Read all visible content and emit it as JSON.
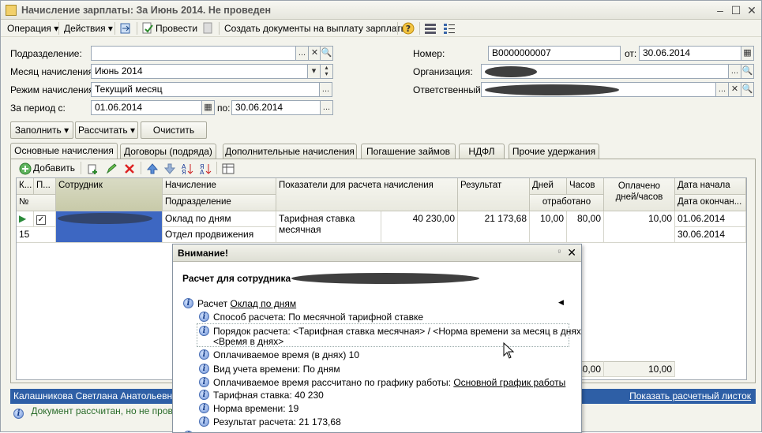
{
  "window": {
    "title": "Начисление зарплаты: За Июнь 2014. Не проведен"
  },
  "toolbar": {
    "operation": "Операция",
    "actions": "Действия",
    "post": "Провести",
    "create_docs": "Создать документы на выплату зарплаты"
  },
  "form": {
    "subdivision_label": "Подразделение:",
    "subdivision_value": "",
    "month_label": "Месяц начисления:",
    "month_value": "Июнь 2014",
    "mode_label": "Режим начисления:",
    "mode_value": "Текущий месяц",
    "period_label": "За период с:",
    "period_from": "01.06.2014",
    "period_to_label": "по:",
    "period_to": "30.06.2014",
    "number_label": "Номер:",
    "number_value": "В0000000007",
    "date_label": "от:",
    "date_value": "30.06.2014",
    "org_label": "Организация:",
    "resp_label": "Ответственный:"
  },
  "buttons": {
    "fill": "Заполнить",
    "calc": "Рассчитать",
    "clear": "Очистить"
  },
  "tabs": [
    "Основные начисления",
    "Договоры (подряда)",
    "Дополнительные начисления",
    "Погашение займов",
    "НДФЛ",
    "Прочие удержания"
  ],
  "grid_toolbar": {
    "add": "Добавить"
  },
  "grid": {
    "headers": {
      "k": "К...",
      "p": "П...",
      "employee": "Сотрудник",
      "accrual": "Начисление",
      "subdivision": "Подразделение",
      "indicators": "Показатели для расчета начисления",
      "result": "Результат",
      "days": "Дней",
      "hours": "Часов",
      "worked": "отработано",
      "paid": "Оплачено дней/часов",
      "start": "Дата начала",
      "end": "Дата окончан...",
      "num": "№"
    },
    "row": {
      "num": "15",
      "accrual": "Оклад по дням",
      "subdivision": "Отдел продвижения",
      "indicator": "Тарифная ставка месячная",
      "indicator_value": "40 230,00",
      "result": "21 173,68",
      "days": "10,00",
      "hours": "80,00",
      "paid": "10,00",
      "start": "01.06.2014",
      "end": "30.06.2014"
    },
    "totals": {
      "hours": "80,00",
      "paid": "10,00"
    }
  },
  "status": {
    "employee": "Калашникова Светлана Анатольевна. Р",
    "show_sheet": "Показать расчетный листок",
    "doc_msg": "Документ рассчитан, но не проведе"
  },
  "popup": {
    "title": "Внимание!",
    "heading": "Расчет для сотрудника",
    "calc_prefix": "Расчет ",
    "calc_link": "Оклад по дням",
    "lines": [
      "Способ расчета: По месячной тарифной ставке",
      "Порядок расчета: <Тарифная ставка месячная> / <Норма времени за месяц в днях> *",
      "<Время в днях>",
      "Оплачиваемое время (в днях) 10",
      "Вид учета времени: По дням",
      "Оплачиваемое время рассчитано по графику работы: ",
      "Тарифная ставка: 40 230",
      "Норма времени: 19",
      "Результат расчета: 21 173,68"
    ],
    "schedule_link": "Основной график работы"
  }
}
